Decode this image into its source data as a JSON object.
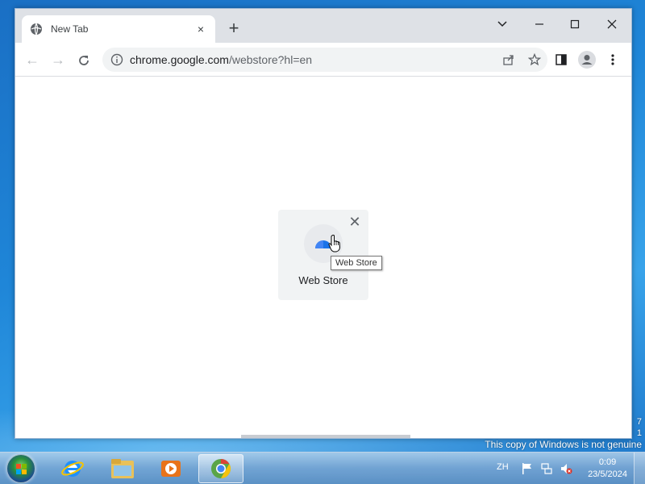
{
  "browser": {
    "tab": {
      "title": "New Tab",
      "favicon": "globe-icon",
      "close_glyph": "×"
    },
    "new_tab_glyph": "+",
    "window_controls": {
      "dropdown": "⌄",
      "minimize": "—",
      "maximize": "☐",
      "close": "✕"
    },
    "nav": {
      "back": "←",
      "forward": "→",
      "reload": "↻"
    },
    "address": {
      "host": "chrome.google.com",
      "path": "/webstore?hl=en",
      "info_icon": "info-icon"
    },
    "toolbar_icons": [
      "share-icon",
      "star-icon",
      "side-panel-icon",
      "profile-icon",
      "menu-icon"
    ]
  },
  "content": {
    "shortcut": {
      "label": "Web Store",
      "remove_glyph": "✕",
      "icon": "web-store-icon"
    },
    "tooltip": "Web Store"
  },
  "desktop": {
    "watermark_line1": "This copy of Windows is not genuine",
    "watermark_partial_top": "7",
    "watermark_partial_mid": "1"
  },
  "taskbar": {
    "apps": [
      "internet-explorer-icon",
      "file-explorer-icon",
      "media-player-icon",
      "chrome-icon"
    ],
    "language": "ZH",
    "time": "0:09",
    "date": "23/5/2024"
  },
  "colors": {
    "accent_blue": "#1a73e8",
    "titlebar": "#dee1e6",
    "omnibox": "#f1f3f4"
  }
}
